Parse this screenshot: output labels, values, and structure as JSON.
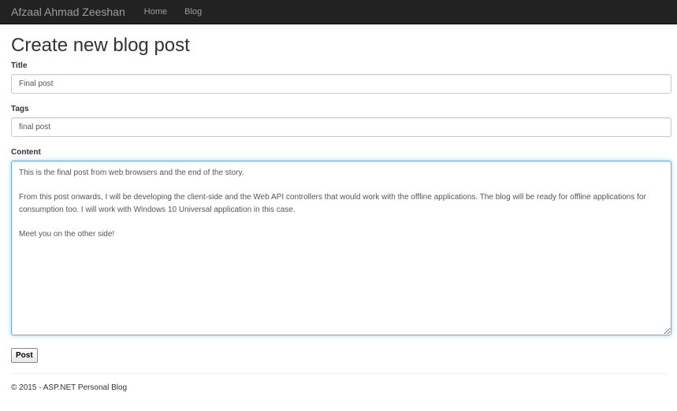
{
  "nav": {
    "brand": "Afzaal Ahmad Zeeshan",
    "links": [
      "Home",
      "Blog"
    ]
  },
  "page": {
    "title": "Create new blog post"
  },
  "form": {
    "title_label": "Title",
    "title_value": "Final post",
    "tags_label": "Tags",
    "tags_value": "final post",
    "content_label": "Content",
    "content_value": "This is the final post from web browsers and the end of the story.\n\nFrom this post onwards, I will be developing the client-side and the Web API controllers that would work with the offline applications. The blog will be ready for offline applications for consumption too. I will work with Windows 10 Universal application in this case.\n\nMeet you on the other side!",
    "post_label": "Post"
  },
  "footer": {
    "text": "© 2015 - ASP.NET Personal Blog"
  },
  "colors": {
    "navbar": "#222222",
    "nav_text": "#9d9d9d",
    "focus_border": "#66afe9"
  }
}
